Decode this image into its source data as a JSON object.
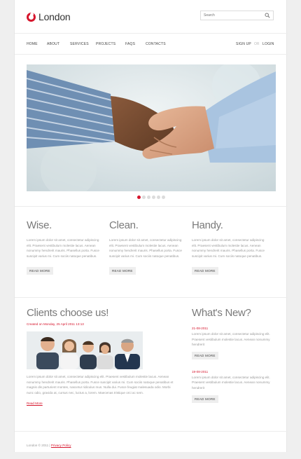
{
  "header": {
    "logo_text": "London",
    "search_placeholder": "Search"
  },
  "nav": {
    "items": [
      "HOME",
      "ABOUT",
      "SERVICES",
      "PROJECTS",
      "FAQS",
      "CONTACTS"
    ],
    "signup": "SIGN UP",
    "separator": "OR",
    "login": "LOGIN"
  },
  "slider": {
    "image": "handshake-photo",
    "slide_count": 6,
    "active_slide": 1
  },
  "features": [
    {
      "title": "Wise.",
      "text": "Lorem ipsum dolor sit amet, consectetur adipiscing elit. Praesent vestibulum molestie lacus. Aenean nonummy hendrerit mauris. Phasellus porta. Fusce suscipit varius mi. Cum sociis natoque penatibus.",
      "button": "READ MORE"
    },
    {
      "title": "Clean.",
      "text": "Lorem ipsum dolor sit amet, consectetur adipiscing elit. Praesent vestibulum molestie lacus. Aenean nonummy hendrerit mauris. Phasellus porta. Fusce suscipit varius mi. Cum sociis natoque penatibus.",
      "button": "READ MORE"
    },
    {
      "title": "Handy.",
      "text": "Lorem ipsum dolor sit amet, consectetur adipiscing elit. Praesent vestibulum molestie lacus. Aenean nonummy hendrerit mauris. Phasellus porta. Fusce suscipit varius mi. Cum sociis natoque penatibus.",
      "button": "READ MORE"
    }
  ],
  "clients": {
    "title": "Clients choose us!",
    "created": "Created on Monday, 25 April 2011 13:13",
    "image": "team-photo",
    "text": "Lorem ipsum dolor sit amet, consectetur adipiscing elit. Praesent vestibulum molestie lacus. Aenean nonummy hendrerit mauris. Phasellus porta. Fusce suscipit varius mi. Cum sociis natoque penatibus et magnis dis parturient montes, nascetur ridiculus mus. Nulla dui. Fusce feugiat malesuada odio. Morbi nunc odio, gravida at, cursus nec, luctus a, lorem. Maecenas tristique orci ac sem.",
    "link": "Read More"
  },
  "news": {
    "title": "What's New?",
    "items": [
      {
        "date": "21-08-2011",
        "text": "Lorem ipsum dolor sit amet, consectetur adipiscing elit. Praesent vestibulum molestie lacus. Aenean nonummy hendrerit",
        "button": "READ MORE"
      },
      {
        "date": "19-08-2011",
        "text": "Lorem ipsum dolor sit amet, consectetur adipiscing elit. Praesent vestibulum molestie lacus. Aenean nonummy hendrerit",
        "button": "READ MORE"
      }
    ]
  },
  "footer": {
    "copyright": "London © 2011 |",
    "privacy": "Privacy Policy"
  },
  "colors": {
    "accent": "#d6152c",
    "background": "#efefef",
    "panel": "#ffffff"
  }
}
